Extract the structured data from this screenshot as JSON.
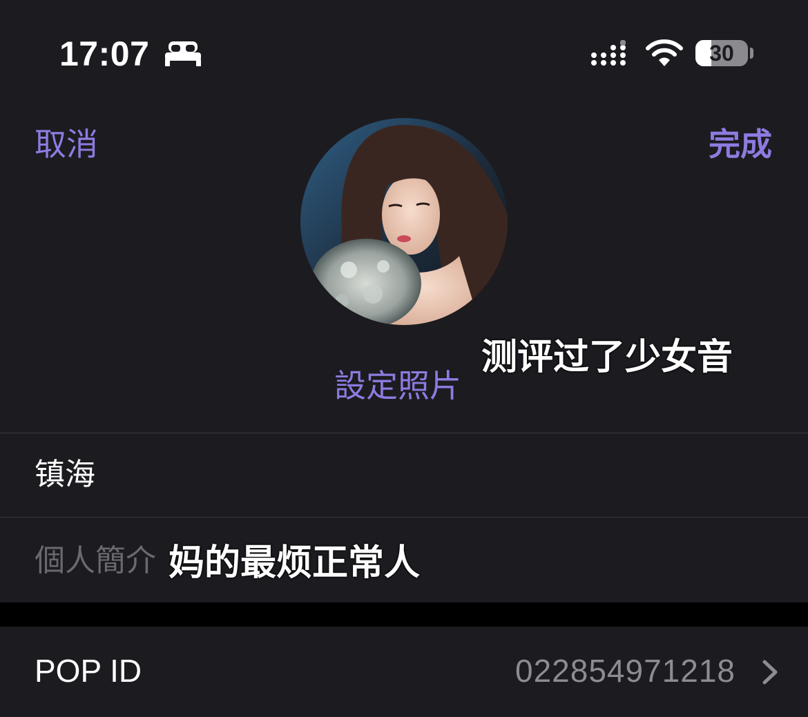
{
  "status_bar": {
    "time": "17:07",
    "focus_icon": "bed-icon",
    "signal_icon": "cellular-signal-icon",
    "wifi_icon": "wifi-icon",
    "battery_level": "30",
    "battery_fraction": 0.3
  },
  "nav": {
    "cancel_label": "取消",
    "done_label": "完成"
  },
  "profile": {
    "set_photo_label": "設定照片",
    "name": "镇海",
    "bio_placeholder": "個人簡介"
  },
  "overlays": {
    "caption_1": "测评过了少女音",
    "caption_2": "妈的最烦正常人"
  },
  "pop_id": {
    "label": "POP ID",
    "value": "022854971218",
    "chevron_icon": "chevron-right-icon"
  },
  "colors": {
    "accent": "#8e7be0",
    "background": "#1c1b20",
    "separator": "#3a393f",
    "secondary_text": "#8d8c92"
  }
}
